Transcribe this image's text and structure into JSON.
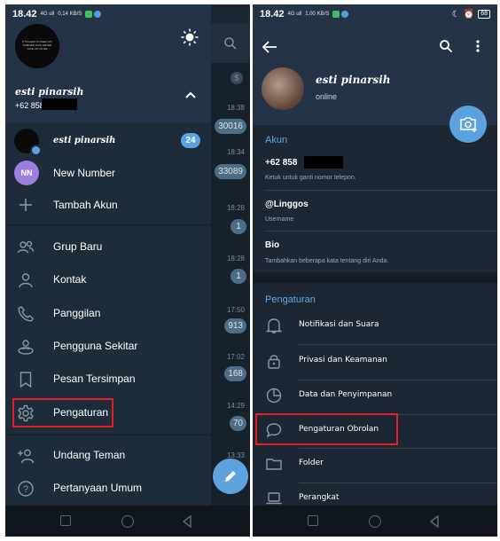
{
  "left": {
    "status": {
      "time": "18.42",
      "signal": "4G ull",
      "speed": "0,14 KB/S",
      "battery": "68"
    },
    "profile": {
      "name": "esti pinarsih",
      "phone": "+62 858",
      "avatar_text": "IT'S HARD TO KEEP MY FRIENDS WHO NEVER GIVE UP ON ME"
    },
    "accounts": [
      {
        "name": "esti pinarsih",
        "badge": "24"
      },
      {
        "initials": "NN",
        "name": "New Number"
      },
      {
        "name": "Tambah Akun"
      }
    ],
    "menu": [
      {
        "label": "Grup Baru",
        "icon": "group-icon"
      },
      {
        "label": "Kontak",
        "icon": "contact-icon"
      },
      {
        "label": "Panggilan",
        "icon": "phone-icon"
      },
      {
        "label": "Pengguna Sekitar",
        "icon": "nearby-icon"
      },
      {
        "label": "Pesan Tersimpan",
        "icon": "bookmark-icon"
      },
      {
        "label": "Pengaturan",
        "icon": "gear-icon"
      },
      {
        "label": "Undang Teman",
        "icon": "add-user-icon"
      },
      {
        "label": "Pertanyaan Umum",
        "icon": "help-icon"
      }
    ],
    "chat_strip": {
      "times": [
        "18:38",
        "18:34",
        "18:28",
        "18:28",
        "17:50",
        "17:02",
        "14:29",
        "13:33"
      ],
      "counts": [
        "30016",
        "33089",
        "1",
        "1",
        "913",
        "168",
        "70"
      ]
    }
  },
  "right": {
    "status": {
      "time": "18.42",
      "signal": "4G ull",
      "speed": "1,00 KB/S",
      "battery": "68"
    },
    "profile": {
      "name": "esti pinarsih",
      "status": "online"
    },
    "akun": {
      "title": "Akun",
      "phone": "+62 858",
      "phone_hint": "Ketuk untuk ganti nomor telepon.",
      "username": "@Linggos",
      "username_label": "Username",
      "bio": "Bio",
      "bio_hint": "Tambahkan beberapa kata tentang diri Anda."
    },
    "pengaturan": {
      "title": "Pengaturan",
      "items": [
        {
          "label": "Notifikasi dan Suara",
          "icon": "bell-icon"
        },
        {
          "label": "Privasi dan Keamanan",
          "icon": "lock-icon"
        },
        {
          "label": "Data dan Penyimpanan",
          "icon": "pie-icon"
        },
        {
          "label": "Pengaturan Obrolan",
          "icon": "chat-bubble-icon"
        },
        {
          "label": "Folder",
          "icon": "folder-icon"
        },
        {
          "label": "Perangkat",
          "icon": "laptop-icon"
        }
      ]
    }
  },
  "colors": {
    "accent": "#5aa3e0",
    "highlight": "#e21f26",
    "bg": "#1d2733"
  }
}
